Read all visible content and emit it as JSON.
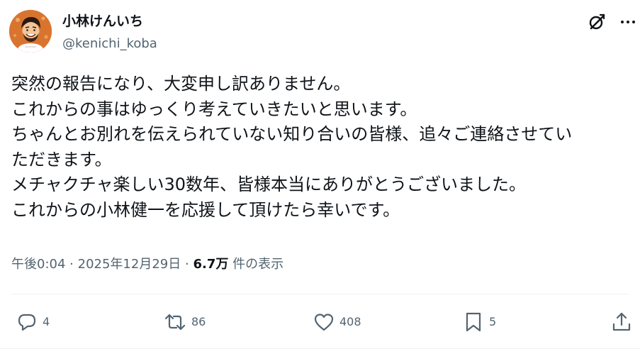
{
  "user": {
    "display_name": "小林けんいち",
    "handle": "@kenichi_koba",
    "avatar_icon": "profile-avatar"
  },
  "header_icons": {
    "grok": "grok-icon",
    "more": "more-icon"
  },
  "tweet": {
    "lines": [
      "突然の報告になり、大変申し訳ありません。",
      "これからの事はゆっくり考えていきたいと思います。",
      "ちゃんとお別れを伝えられていない知り合いの皆様、追々ご連絡させてい",
      "ただきます。",
      "メチャクチャ楽しい30数年、皆様本当にありがとうございました。",
      "これからの小林健一を応援して頂けたら幸いです。"
    ]
  },
  "meta": {
    "time": "午後0:04",
    "separator": "·",
    "date": "2025年12月29日",
    "views_count": "6.7万",
    "views_label": "件の表示"
  },
  "actions": {
    "reply_count": "4",
    "retweet_count": "86",
    "like_count": "408",
    "bookmark_count": "5"
  },
  "colors": {
    "text": "#0f1419",
    "secondary": "#536471",
    "divider": "#eff3f4"
  }
}
